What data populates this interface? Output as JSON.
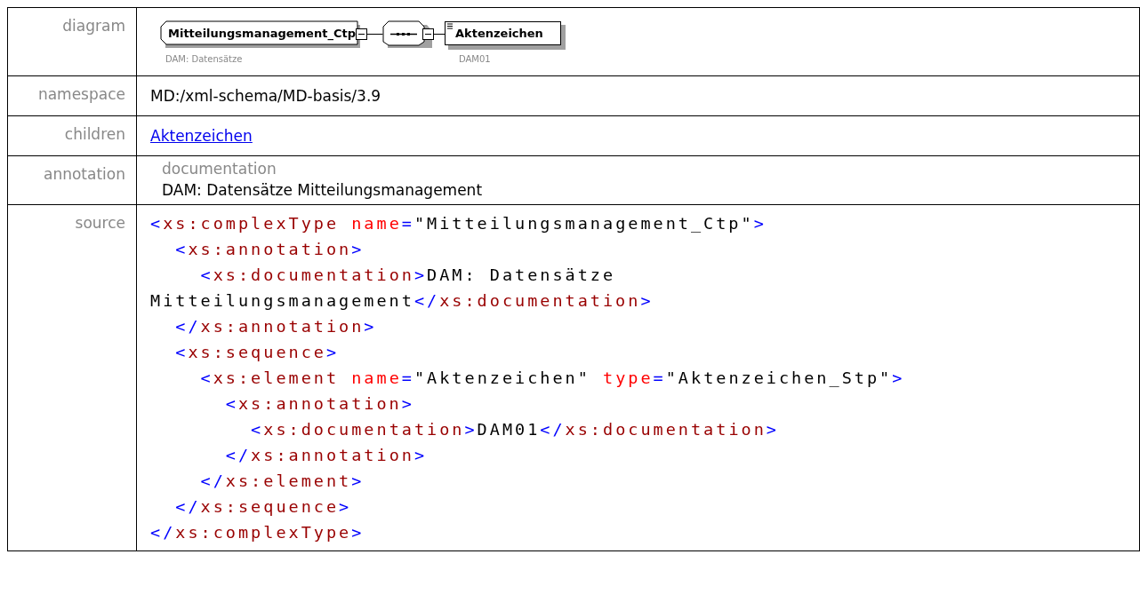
{
  "diagram": {
    "label": "diagram",
    "type_node": {
      "name": "Mitteilungsmanagement_Ctp",
      "caption": "DAM: Datensätze"
    },
    "element_node": {
      "name": "Aktenzeichen",
      "caption": "DAM01"
    }
  },
  "rows": [
    {
      "label": "namespace",
      "kind": "text",
      "text": "MD:/xml-schema/MD-basis/3.9"
    },
    {
      "label": "children",
      "kind": "link",
      "text": "Aktenzeichen"
    },
    {
      "label": "annotation",
      "kind": "annotation",
      "heading": "documentation",
      "text": "DAM: Datensätze Mitteilungsmanagement"
    }
  ],
  "source": {
    "label": "source",
    "lines": [
      [
        {
          "kind": "punct",
          "text": "<"
        },
        {
          "kind": "tag",
          "text": "xs:complexType "
        },
        {
          "kind": "attr",
          "text": "name"
        },
        {
          "kind": "punct",
          "text": "="
        },
        {
          "kind": "text",
          "text": "\"Mitteilungsmanagement_Ctp\""
        },
        {
          "kind": "punct",
          "text": ">"
        }
      ],
      [
        {
          "kind": "punct",
          "text": "  <"
        },
        {
          "kind": "tag",
          "text": "xs:annotation"
        },
        {
          "kind": "punct",
          "text": ">"
        }
      ],
      [
        {
          "kind": "punct",
          "text": "    <"
        },
        {
          "kind": "tag",
          "text": "xs:documentation"
        },
        {
          "kind": "punct",
          "text": ">"
        },
        {
          "kind": "text",
          "text": "DAM: Datensätze"
        }
      ],
      [
        {
          "kind": "text",
          "text": "Mitteilungsmanagement"
        },
        {
          "kind": "punct",
          "text": "</"
        },
        {
          "kind": "tag",
          "text": "xs:documentation"
        },
        {
          "kind": "punct",
          "text": ">"
        }
      ],
      [
        {
          "kind": "punct",
          "text": "  </"
        },
        {
          "kind": "tag",
          "text": "xs:annotation"
        },
        {
          "kind": "punct",
          "text": ">"
        }
      ],
      [
        {
          "kind": "punct",
          "text": "  <"
        },
        {
          "kind": "tag",
          "text": "xs:sequence"
        },
        {
          "kind": "punct",
          "text": ">"
        }
      ],
      [
        {
          "kind": "punct",
          "text": "    <"
        },
        {
          "kind": "tag",
          "text": "xs:element "
        },
        {
          "kind": "attr",
          "text": "name"
        },
        {
          "kind": "punct",
          "text": "="
        },
        {
          "kind": "text",
          "text": "\"Aktenzeichen\" "
        },
        {
          "kind": "attr",
          "text": "type"
        },
        {
          "kind": "punct",
          "text": "="
        },
        {
          "kind": "text",
          "text": "\"Aktenzeichen_Stp\""
        },
        {
          "kind": "punct",
          "text": ">"
        }
      ],
      [
        {
          "kind": "punct",
          "text": "      <"
        },
        {
          "kind": "tag",
          "text": "xs:annotation"
        },
        {
          "kind": "punct",
          "text": ">"
        }
      ],
      [
        {
          "kind": "punct",
          "text": "        <"
        },
        {
          "kind": "tag",
          "text": "xs:documentation"
        },
        {
          "kind": "punct",
          "text": ">"
        },
        {
          "kind": "text",
          "text": "DAM01"
        },
        {
          "kind": "punct",
          "text": "</"
        },
        {
          "kind": "tag",
          "text": "xs:documentation"
        },
        {
          "kind": "punct",
          "text": ">"
        }
      ],
      [
        {
          "kind": "punct",
          "text": "      </"
        },
        {
          "kind": "tag",
          "text": "xs:annotation"
        },
        {
          "kind": "punct",
          "text": ">"
        }
      ],
      [
        {
          "kind": "punct",
          "text": "    </"
        },
        {
          "kind": "tag",
          "text": "xs:element"
        },
        {
          "kind": "punct",
          "text": ">"
        }
      ],
      [
        {
          "kind": "punct",
          "text": "  </"
        },
        {
          "kind": "tag",
          "text": "xs:sequence"
        },
        {
          "kind": "punct",
          "text": ">"
        }
      ],
      [
        {
          "kind": "punct",
          "text": "</"
        },
        {
          "kind": "tag",
          "text": "xs:complexType"
        },
        {
          "kind": "punct",
          "text": ">"
        }
      ]
    ]
  }
}
